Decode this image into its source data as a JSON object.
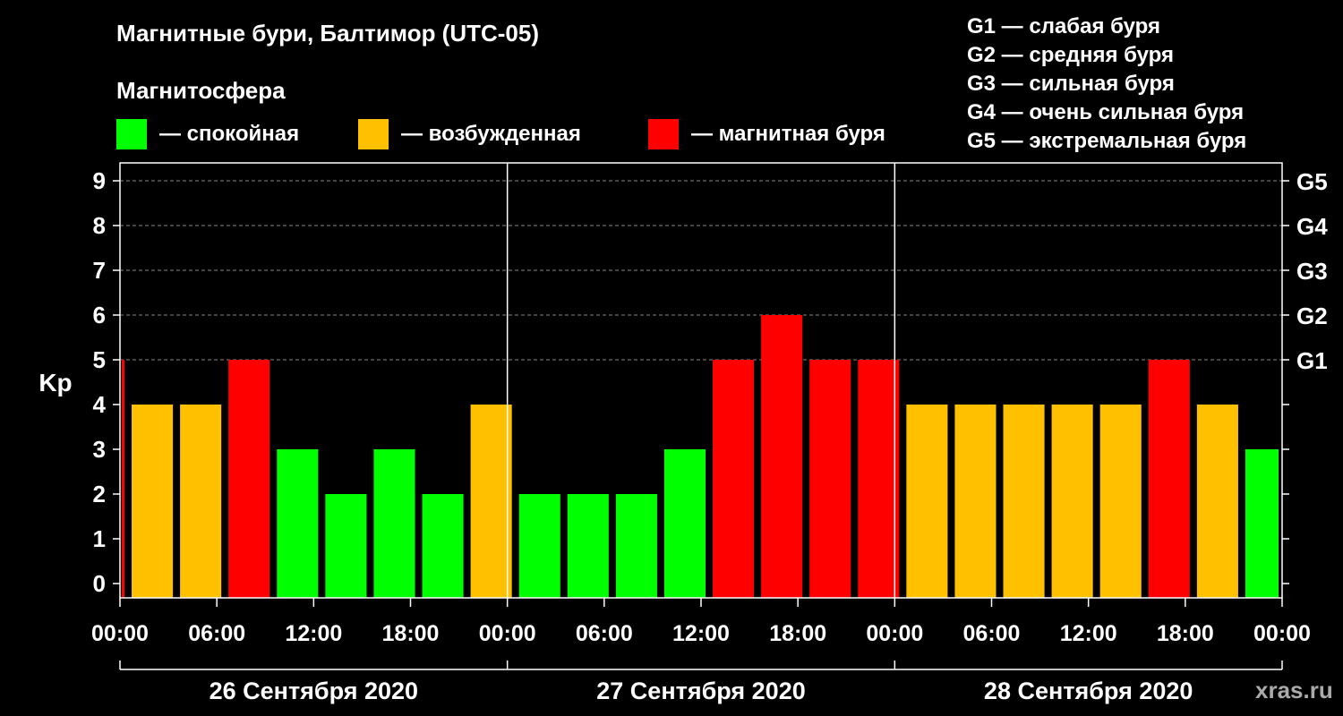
{
  "title": "Магнитные бури, Балтимор (UTC-05)",
  "subtitle": "Магнитосфера",
  "legend": [
    {
      "label": "— спокойная",
      "color": "#00ff00"
    },
    {
      "label": "— возбужденная",
      "color": "#ffc000"
    },
    {
      "label": "— магнитная буря",
      "color": "#ff0000"
    }
  ],
  "g_scale": [
    "G1 — слабая буря",
    "G2 — средняя буря",
    "G3 — сильная буря",
    "G4 — очень сильная буря",
    "G5 — экстремальная буря"
  ],
  "watermark": "xras.ru",
  "chart_data": {
    "type": "bar",
    "ylabel": "Kp",
    "ylim": [
      0,
      9
    ],
    "yticks": [
      "0",
      "1",
      "2",
      "3",
      "4",
      "5",
      "6",
      "7",
      "8",
      "9"
    ],
    "right_ticks": [
      {
        "kp": 5,
        "label": "G1"
      },
      {
        "kp": 6,
        "label": "G2"
      },
      {
        "kp": 7,
        "label": "G3"
      },
      {
        "kp": 8,
        "label": "G4"
      },
      {
        "kp": 9,
        "label": "G5"
      }
    ],
    "grid": true,
    "hours_total": 72,
    "first_bar_partial_hours": 0.5,
    "xticks": [
      "00:00",
      "06:00",
      "12:00",
      "18:00",
      "00:00",
      "06:00",
      "12:00",
      "18:00",
      "00:00",
      "06:00",
      "12:00",
      "18:00",
      "00:00"
    ],
    "days": [
      "26 Сентября 2020",
      "27 Сентября 2020",
      "28 Сентября 2020"
    ],
    "values": [
      5,
      4,
      4,
      5,
      3,
      2,
      3,
      2,
      4,
      2,
      2,
      2,
      3,
      5,
      6,
      5,
      5,
      4,
      4,
      4,
      4,
      4,
      5,
      4,
      3
    ],
    "colors": {
      "quiet": "#00ff00",
      "active": "#ffc000",
      "storm": "#ff0000"
    }
  }
}
